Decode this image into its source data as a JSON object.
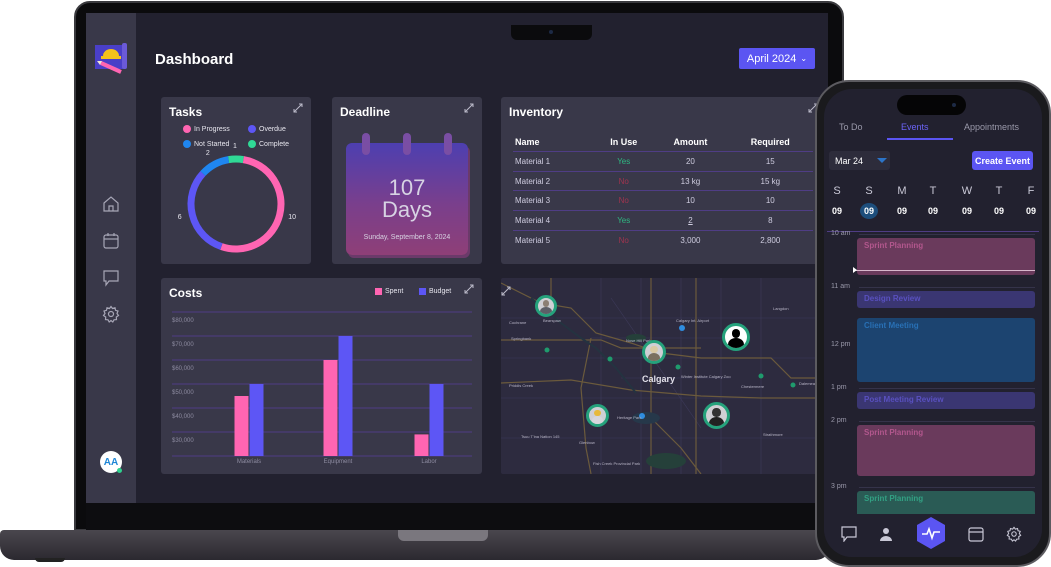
{
  "dashboard": {
    "title": "Dashboard",
    "month_selector": {
      "value": "April 2024",
      "icon": "chevron-down-icon"
    },
    "sidebar": {
      "logo": "construction-blueprint-logo",
      "items": [
        {
          "name": "home",
          "icon": "home-icon"
        },
        {
          "name": "calendar",
          "icon": "calendar-icon"
        },
        {
          "name": "messages",
          "icon": "chat-icon"
        },
        {
          "name": "settings",
          "icon": "gear-icon"
        }
      ],
      "avatar": {
        "initials": "AA",
        "status": "online"
      }
    },
    "tasks": {
      "title": "Tasks",
      "legend": [
        {
          "label": "In Progress",
          "color": "#ff65b2"
        },
        {
          "label": "Overdue",
          "color": "#5d56f5"
        },
        {
          "label": "Not Started",
          "color": "#1f86f0"
        },
        {
          "label": "Complete",
          "color": "#30d996"
        }
      ]
    },
    "deadline": {
      "title": "Deadline",
      "count": "107",
      "unit": "Days",
      "date": "Sunday, September 8, 2024"
    },
    "inventory": {
      "title": "Inventory",
      "columns": [
        "Name",
        "In Use",
        "Amount",
        "Required"
      ],
      "rows": [
        {
          "name": "Material 1",
          "in_use": "Yes",
          "amount": "20",
          "required": "15"
        },
        {
          "name": "Material 2",
          "in_use": "No",
          "amount": "13 kg",
          "required": "15 kg"
        },
        {
          "name": "Material 3",
          "in_use": "No",
          "amount": "10",
          "required": "10"
        },
        {
          "name": "Material 4",
          "in_use": "Yes",
          "amount": "2",
          "required": "8"
        },
        {
          "name": "Material 5",
          "in_use": "No",
          "amount": "3,000",
          "required": "2,800"
        }
      ]
    },
    "costs": {
      "title": "Costs"
    },
    "map": {
      "city": "Calgary",
      "places": [
        "Cochrane",
        "Nose Hill Park",
        "Calgary Int. Airport",
        "Winter Institute Calgary Zoo",
        "Heritage Park",
        "Chestermere",
        "Fish Creek Provincial Park",
        "Bearspaw",
        "Springbank",
        "Priddis Creek",
        "Tsuu T'ina Nation 145",
        "Glenbow",
        "Langdon",
        "Strathmore",
        "Dalemead"
      ]
    }
  },
  "chart_data": [
    {
      "type": "pie",
      "title": "Tasks",
      "style": "donut",
      "categories": [
        "In Progress",
        "Overdue",
        "Not Started",
        "Complete"
      ],
      "values": [
        10,
        6,
        2,
        1
      ],
      "colors": [
        "#ff65b2",
        "#5d56f5",
        "#1f86f0",
        "#30d996"
      ],
      "legend": "top"
    },
    {
      "type": "bar",
      "title": "Costs",
      "categories": [
        "Materials",
        "Equipment",
        "Labor"
      ],
      "series": [
        {
          "name": "Spent",
          "values": [
            45000,
            60000,
            29000
          ],
          "color": "#ff65b2"
        },
        {
          "name": "Budget",
          "values": [
            50000,
            70000,
            50000
          ],
          "color": "#5d56f5"
        }
      ],
      "ylim": [
        20000,
        80000
      ],
      "yticks": [
        "$30,000",
        "$40,000",
        "$50,000",
        "$60,000",
        "$70,000",
        "$80,000"
      ],
      "grid": true,
      "legend": "top-right",
      "xlabel": "",
      "ylabel": ""
    }
  ],
  "phone": {
    "tabs": [
      {
        "label": "To Do",
        "active": false
      },
      {
        "label": "Events",
        "active": true
      },
      {
        "label": "Appointments",
        "active": false
      }
    ],
    "date_select": "Mar 24",
    "create_button": "Create Event",
    "week": [
      {
        "day": "S",
        "date": "09",
        "selected": false
      },
      {
        "day": "S",
        "date": "09",
        "selected": true
      },
      {
        "day": "M",
        "date": "09",
        "selected": false
      },
      {
        "day": "T",
        "date": "09",
        "selected": false
      },
      {
        "day": "W",
        "date": "09",
        "selected": false
      },
      {
        "day": "T",
        "date": "09",
        "selected": false
      },
      {
        "day": "F",
        "date": "09",
        "selected": false
      }
    ],
    "times": [
      "10 am",
      "11 am",
      "12 pm",
      "1 pm",
      "2 pm",
      "3 pm"
    ],
    "events": [
      {
        "title": "Sprint Planning",
        "color": "pink"
      },
      {
        "title": "Design Review",
        "color": "purple"
      },
      {
        "title": "Client Meeting",
        "color": "blue"
      },
      {
        "title": "Post Meeting Review",
        "color": "purple"
      },
      {
        "title": "Sprint Planning",
        "color": "pink"
      },
      {
        "title": "Sprint Planning",
        "color": "green"
      }
    ],
    "bottom_nav": [
      "chat-icon",
      "user-icon",
      "activity-icon",
      "calendar-icon",
      "gear-icon"
    ]
  }
}
